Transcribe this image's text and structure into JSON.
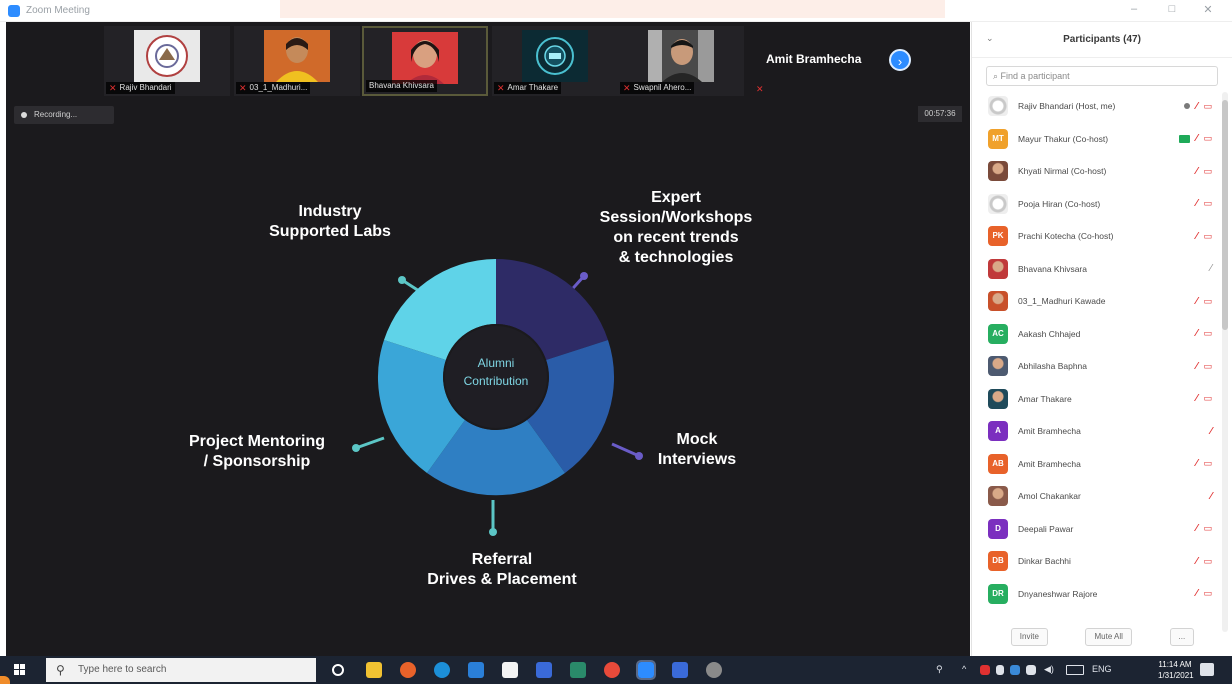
{
  "window": {
    "title": "Zoom Meeting"
  },
  "participant_strip": {
    "tiles": [
      {
        "name": "Rajiv Bhandari",
        "kind": "logo"
      },
      {
        "name": "03_1_Madhuri...",
        "kind": "woman-yellow"
      },
      {
        "name": "Bhavana Khivsara",
        "kind": "woman-red",
        "active": true
      },
      {
        "name": "Amar Thakare",
        "kind": "tech-logo"
      },
      {
        "name": "Swapnil Ahero...",
        "kind": "man"
      }
    ],
    "active_speaker": "Amit Bramhecha"
  },
  "recording": {
    "label": "Recording..."
  },
  "timer": {
    "value": "00:57:36"
  },
  "slide": {
    "center_label_line1": "Alumni",
    "center_label_line2": "Contribution",
    "labels": [
      {
        "text_line1": "Industry",
        "text_line2": "Supported Labs"
      },
      {
        "text_line1": "Expert",
        "text_line2": "Session/Workshops",
        "text_line3": "on recent trends",
        "text_line4": "& technologies"
      },
      {
        "text_line1": "Mock",
        "text_line2": "Interviews"
      },
      {
        "text_line1": "Referral",
        "text_line2": "Drives & Placement"
      },
      {
        "text_line1": "Project Mentoring",
        "text_line2": "/ Sponsorship"
      }
    ],
    "colors": {
      "segment_dark": "#2e2b66",
      "segment_mid": "#2a5ca8",
      "segment_blue": "#2f7fc3",
      "segment_light": "#3aa6d8",
      "segment_cyan": "#5fd3e8",
      "connector_teal": "#5cc6c6",
      "connector_purple": "#6a5cc8"
    }
  },
  "participants_panel": {
    "title": "Participants (47)",
    "search_placeholder": "Find a participant",
    "participants": [
      {
        "name": "Rajiv Bhandari (Host, me)",
        "avatar": "logo",
        "color": "#b8b8b8",
        "initials": "",
        "hand": true,
        "mic_muted": true,
        "cam_off": true
      },
      {
        "name": "Mayur Thakur (Co-host)",
        "avatar": "initials",
        "color": "#f0a12b",
        "initials": "MT",
        "screen": true,
        "mic_muted": true,
        "cam_off": true
      },
      {
        "name": "Khyati Nirmal (Co-host)",
        "avatar": "photo",
        "color": "#7a4a3a",
        "initials": "",
        "mic_muted": true,
        "cam_off": true
      },
      {
        "name": "Pooja Hiran (Co-host)",
        "avatar": "logo",
        "color": "#b8b8b8",
        "initials": "",
        "mic_muted": true,
        "cam_off": true
      },
      {
        "name": "Prachi Kotecha (Co-host)",
        "avatar": "initials",
        "color": "#e8622a",
        "initials": "PK",
        "mic_muted": true,
        "cam_off": true
      },
      {
        "name": "Bhavana Khivsara",
        "avatar": "photo",
        "color": "#c0393a",
        "initials": "",
        "mic_grey": true
      },
      {
        "name": "03_1_Madhuri Kawade",
        "avatar": "photo",
        "color": "#c8502a",
        "initials": "",
        "mic_muted": true,
        "cam_off": true
      },
      {
        "name": "Aakash Chhajed",
        "avatar": "initials",
        "color": "#27ae60",
        "initials": "AC",
        "mic_muted": true,
        "cam_off": true
      },
      {
        "name": "Abhilasha Baphna",
        "avatar": "photo",
        "color": "#4d5a70",
        "initials": "",
        "mic_muted": true,
        "cam_off": true
      },
      {
        "name": "Amar Thakare",
        "avatar": "photo",
        "color": "#1f4a5a",
        "initials": "",
        "mic_muted": true,
        "cam_off": true
      },
      {
        "name": "Amit Bramhecha",
        "avatar": "initials",
        "color": "#7b2fbf",
        "initials": "A",
        "mic_muted": true
      },
      {
        "name": "Amit Bramhecha",
        "avatar": "initials",
        "color": "#e8622a",
        "initials": "AB",
        "mic_muted": true,
        "cam_off": true
      },
      {
        "name": "Amol Chakankar",
        "avatar": "photo",
        "color": "#8a5a4a",
        "initials": "",
        "mic_muted": true
      },
      {
        "name": "Deepali Pawar",
        "avatar": "initials",
        "color": "#7b2fbf",
        "initials": "D",
        "mic_muted": true,
        "cam_off": true
      },
      {
        "name": "Dinkar Bachhi",
        "avatar": "initials",
        "color": "#e8622a",
        "initials": "DB",
        "mic_muted": true,
        "cam_off": true
      },
      {
        "name": "Dnyaneshwar Rajore",
        "avatar": "initials",
        "color": "#27ae60",
        "initials": "DR",
        "mic_muted": true,
        "cam_off": true
      }
    ],
    "invite_label": "Invite",
    "mute_all_label": "Mute All",
    "more_label": "..."
  },
  "taskbar": {
    "search_placeholder": "Type here to search",
    "tray_lang": "ENG",
    "time": "11:14 AM",
    "date": "1/31/2021"
  },
  "icons": {
    "mic_muted": "mic-muted-icon",
    "cam_off": "video-off-icon",
    "raised_hand": "hand-icon",
    "screen_share": "screen-share-icon"
  }
}
